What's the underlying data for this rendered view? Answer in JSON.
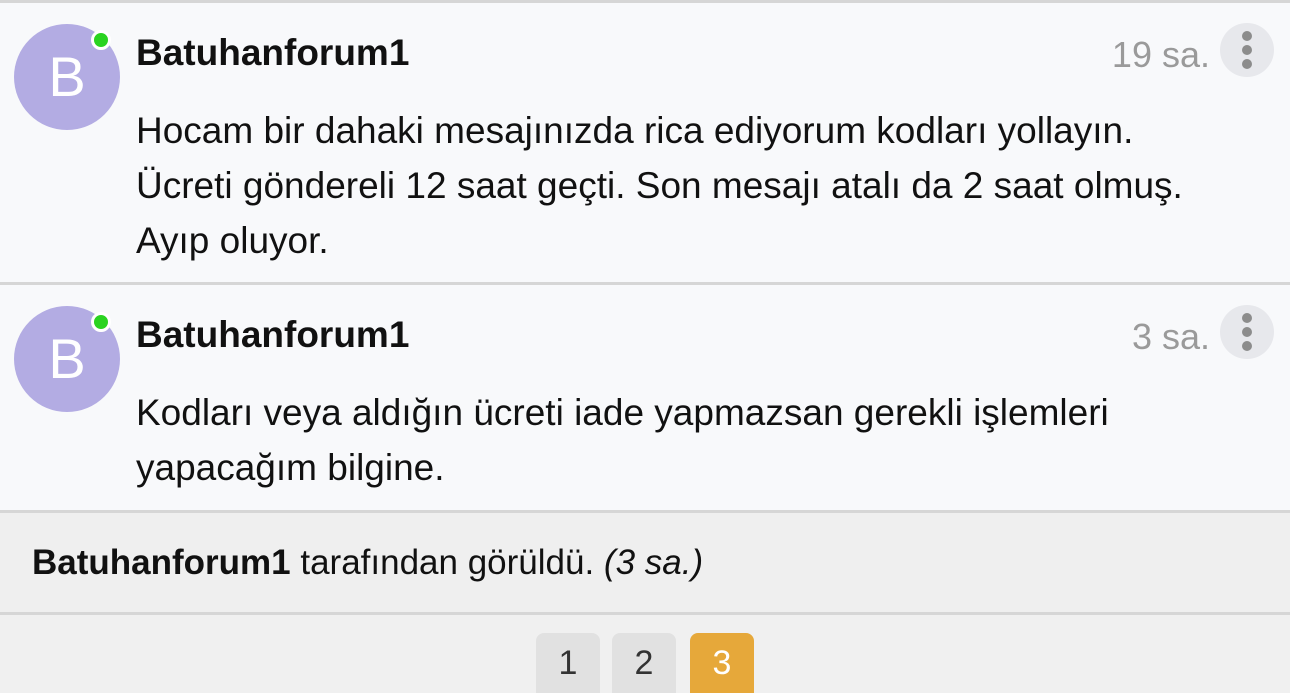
{
  "messages": [
    {
      "avatar_letter": "B",
      "author": "Batuhanforum1",
      "time": "19 sa.",
      "lines": [
        "Hocam bir dahaki mesajınızda rica ediyorum kodları yollayın.",
        "Ücreti göndereli 12 saat geçti. Son mesajı atalı da 2 saat olmuş.",
        "Ayıp oluyor."
      ]
    },
    {
      "avatar_letter": "B",
      "author": "Batuhanforum1",
      "time": "3 sa.",
      "lines": [
        "Kodları veya aldığın ücreti iade yapmazsan gerekli işlemleri",
        "yapacağım bilgine."
      ]
    }
  ],
  "seen": {
    "user": "Batuhanforum1",
    "text": "tarafından görüldü.",
    "time": "(3 sa.)"
  },
  "pagination": {
    "pages": [
      "1",
      "2",
      "3"
    ],
    "active": "3"
  },
  "colors": {
    "avatar": "#b3ace3",
    "online": "#2ad321",
    "active_page": "#e6a83a"
  },
  "icons": {
    "more": "more-vertical-icon"
  }
}
